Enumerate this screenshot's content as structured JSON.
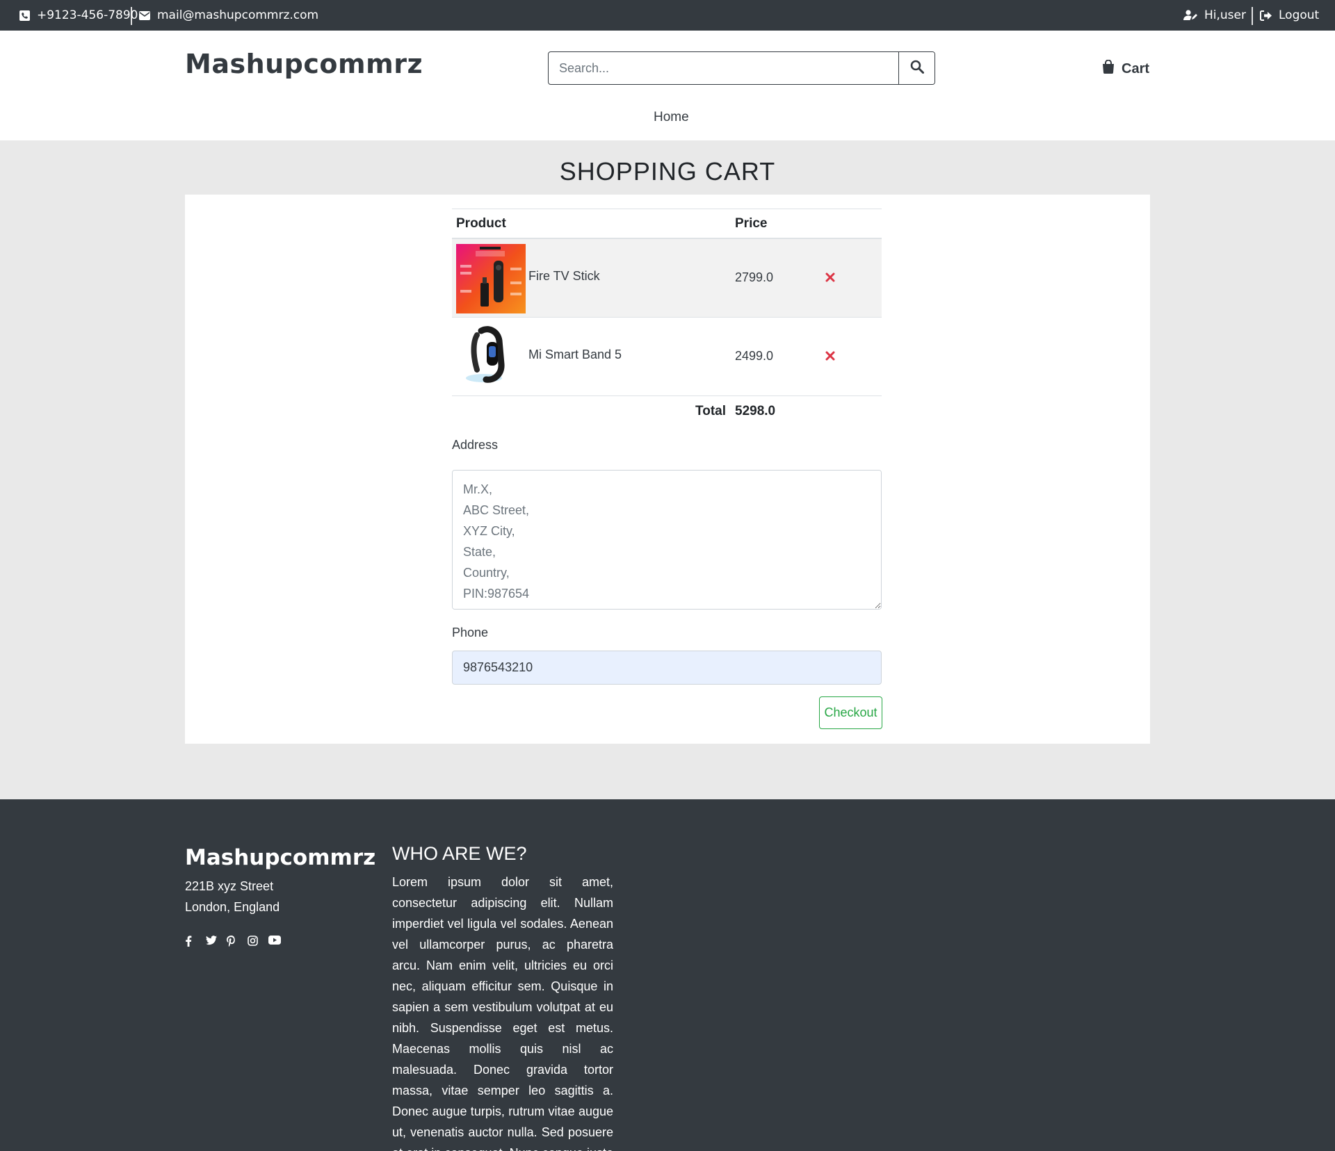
{
  "topbar": {
    "phone": "+9123-456-7890",
    "email": "mail@mashupcommrz.com",
    "greeting": "Hi,user",
    "logout": "Logout"
  },
  "header": {
    "brand": "Mashupcommrz",
    "search_placeholder": "Search...",
    "cart_label": "Cart",
    "nav_home": "Home"
  },
  "cart": {
    "title": "SHOPPING CART",
    "col_product": "Product",
    "col_price": "Price",
    "items": [
      {
        "name": "Fire TV Stick",
        "price": "2799.0"
      },
      {
        "name": "Mi Smart Band 5",
        "price": "2499.0"
      }
    ],
    "total_label": "Total",
    "total_value": "5298.0"
  },
  "form": {
    "address_label": "Address",
    "address_value": "Mr.X,\nABC Street,\nXYZ City,\nState,\nCountry,\nPIN:987654",
    "phone_label": "Phone",
    "phone_value": "9876543210",
    "checkout_label": "Checkout"
  },
  "footer": {
    "brand": "Mashupcommrz",
    "address_line1": "221B xyz Street",
    "address_line2": "London, England",
    "who_title": "WHO ARE WE?",
    "who_text": "Lorem ipsum dolor sit amet, consectetur adipiscing elit. Nullam imperdiet vel ligula vel sodales. Aenean vel ullamcorper purus, ac pharetra arcu. Nam enim velit, ultricies eu orci nec, aliquam efficitur sem. Quisque in sapien a sem vestibulum volutpat at eu nibh. Suspendisse eget est metus. Maecenas mollis quis nisl ac malesuada. Donec gravida tortor massa, vitae semper leo sagittis a. Donec augue turpis, rutrum vitae augue ut, venenatis auctor nulla. Sed posuere at erat in consequat. Nunc congue justo ut ante sodales, bibendum blandit augue finibus."
  },
  "colors": {
    "dark": "#343a40",
    "page_bg": "#e9e9e9",
    "remove": "#dc3545",
    "checkout": "#28a745",
    "phone_bg": "#e8f0fe"
  }
}
